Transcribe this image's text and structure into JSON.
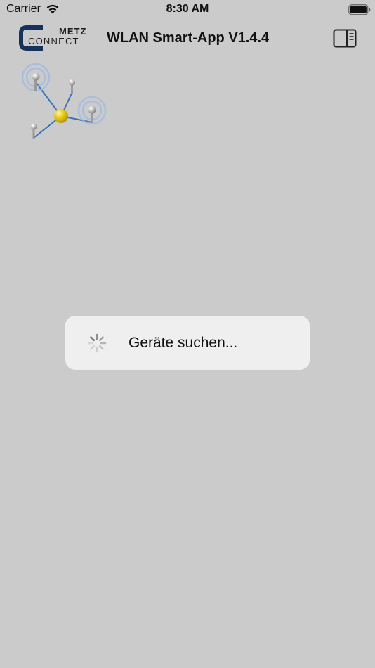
{
  "status_bar": {
    "carrier": "Carrier",
    "time": "8:30 AM",
    "wifi_icon": "wifi-icon",
    "battery_icon": "battery-icon"
  },
  "nav_bar": {
    "logo": {
      "line1": "METZ",
      "line2": "CONNECT",
      "accent_color": "#16325c"
    },
    "title": "WLAN Smart-App V1.4.4",
    "right_icon": "sidebar-toggle-icon"
  },
  "main": {
    "graphic_icon": "network-nodes-icon",
    "loading": {
      "spinner_icon": "spinner-icon",
      "text": "Geräte suchen..."
    }
  },
  "colors": {
    "background": "#cbcbcb",
    "hud_background": "#efefef",
    "node_center": "#e2c30f",
    "link_line": "#3b73b8"
  }
}
